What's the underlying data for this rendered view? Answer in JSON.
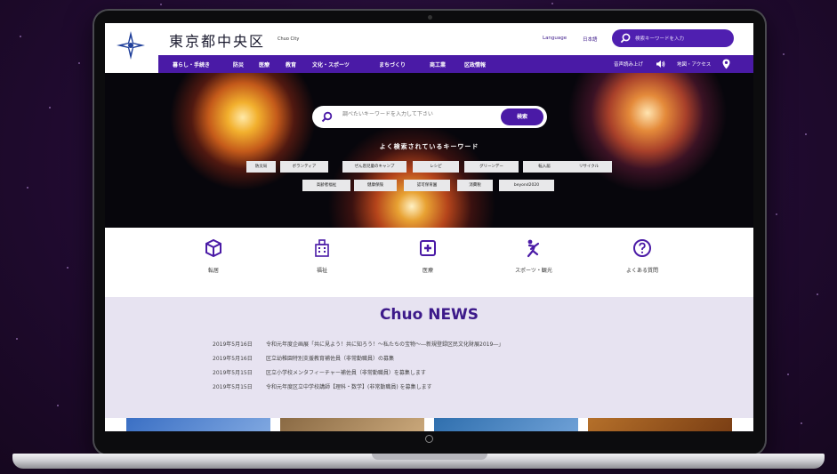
{
  "site": {
    "title": "東京都中央区",
    "subtitle": "Chuo City",
    "language_label": "Language",
    "language_value": "日本語",
    "header_search_placeholder": "検索キーワードを入力"
  },
  "nav": {
    "items": [
      "暮らし・手続き",
      "防災",
      "医療",
      "教育",
      "文化・スポーツ",
      "まちづくり",
      "商工業",
      "区政情報"
    ],
    "read_aloud": "音声読み上げ",
    "map_access": "地図・アクセス"
  },
  "hero": {
    "search_placeholder": "調べたいキーワードを入力して下さい",
    "search_button": "検索",
    "keywords_heading": "よく検索されているキーワード",
    "keywords_row1": [
      "防災局",
      "ボランティア",
      "ぜん息児童のキャンプ",
      "レシピ",
      "グリーンデー",
      "転入届",
      "リサイクル"
    ],
    "keywords_row2": [
      "高齢者福祉",
      "健康保険",
      "認可保育園",
      "消費税",
      "beyond2020"
    ]
  },
  "quick_links": [
    {
      "label": "転居",
      "icon": "package-icon"
    },
    {
      "label": "福祉",
      "icon": "building-icon"
    },
    {
      "label": "医療",
      "icon": "medical-cross-icon"
    },
    {
      "label": "スポーツ・観光",
      "icon": "runner-icon"
    },
    {
      "label": "よくある質問",
      "icon": "question-icon"
    }
  ],
  "news": {
    "title": "Chuo NEWS",
    "items": [
      {
        "date": "2019年5月16日",
        "text": "令和元年度企画展「共に見よう！共に知ろう！～私たちの宝物～―新規登録区民文化財展2019―」"
      },
      {
        "date": "2019年5月16日",
        "text": "区立幼稚園特別支援教育補佐員（非常勤職員）の募集"
      },
      {
        "date": "2019年5月15日",
        "text": "区立小学校メンタフィーチャー補佐員（非常勤職員）を募集します"
      },
      {
        "date": "2019年5月15日",
        "text": "令和元年度区立中学校講師【理科・数学】(非常勤職員) を募集します"
      }
    ]
  },
  "colors": {
    "brand_purple": "#4a1aa6",
    "news_background": "#e7e3f1",
    "page_background": "#240c36"
  }
}
